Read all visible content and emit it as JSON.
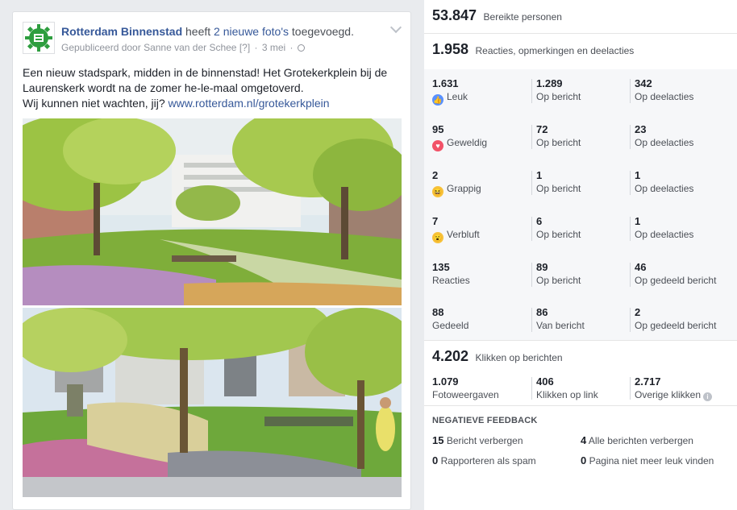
{
  "post": {
    "page_name": "Rotterdam Binnenstad",
    "action_prefix": " heeft ",
    "action_link": "2 nieuwe foto's",
    "action_suffix": " toegevoegd.",
    "published_by": "Gepubliceerd door Sanne van der Schee",
    "help_marker": "[?]",
    "date": "3 mei",
    "text_line1": "Een nieuw stadspark, midden in de binnenstad! Het Grotekerkplein bij de Laurenskerk wordt na de zomer he-le-maal omgetoverd.",
    "text_line2": "Wij kunnen niet wachten, jij? ",
    "link": "www.rotterdam.nl/grotekerkplein"
  },
  "insights": {
    "reach": {
      "value": "53.847",
      "label": "Bereikte personen"
    },
    "engagement": {
      "value": "1.958",
      "label": "Reacties, opmerkingen en deelacties"
    },
    "rows": [
      {
        "total": "1.631",
        "label": "Leuk",
        "icon": "like-icon",
        "on_post": "1.289",
        "on_post_label": "Op bericht",
        "on_shares": "342",
        "on_shares_label": "Op deelacties"
      },
      {
        "total": "95",
        "label": "Geweldig",
        "icon": "love-icon",
        "on_post": "72",
        "on_post_label": "Op bericht",
        "on_shares": "23",
        "on_shares_label": "Op deelacties"
      },
      {
        "total": "2",
        "label": "Grappig",
        "icon": "haha-icon",
        "on_post": "1",
        "on_post_label": "Op bericht",
        "on_shares": "1",
        "on_shares_label": "Op deelacties"
      },
      {
        "total": "7",
        "label": "Verbluft",
        "icon": "wow-icon",
        "on_post": "6",
        "on_post_label": "Op bericht",
        "on_shares": "1",
        "on_shares_label": "Op deelacties"
      },
      {
        "total": "135",
        "label": "Reacties",
        "on_post": "89",
        "on_post_label": "Op bericht",
        "on_shares": "46",
        "on_shares_label": "Op gedeeld bericht"
      },
      {
        "total": "88",
        "label": "Gedeeld",
        "on_post": "86",
        "on_post_label": "Van bericht",
        "on_shares": "2",
        "on_shares_label": "Op gedeeld bericht"
      }
    ],
    "clicks": {
      "value": "4.202",
      "label": "Klikken op berichten"
    },
    "click_breakdown": [
      {
        "value": "1.079",
        "label": "Fotoweergaven"
      },
      {
        "value": "406",
        "label": "Klikken op link"
      },
      {
        "value": "2.717",
        "label": "Overige klikken"
      }
    ],
    "info_glyph": "i",
    "negative_title": "NEGATIEVE FEEDBACK",
    "negative": [
      {
        "value": "15",
        "label": "Bericht verbergen"
      },
      {
        "value": "4",
        "label": "Alle berichten verbergen"
      },
      {
        "value": "0",
        "label": "Rapporteren als spam"
      },
      {
        "value": "0",
        "label": "Pagina niet meer leuk vinden"
      }
    ]
  },
  "colors": {
    "link": "#365899",
    "like": "#5890ff",
    "love": "#f25268",
    "emoji": "#f7c23b"
  }
}
